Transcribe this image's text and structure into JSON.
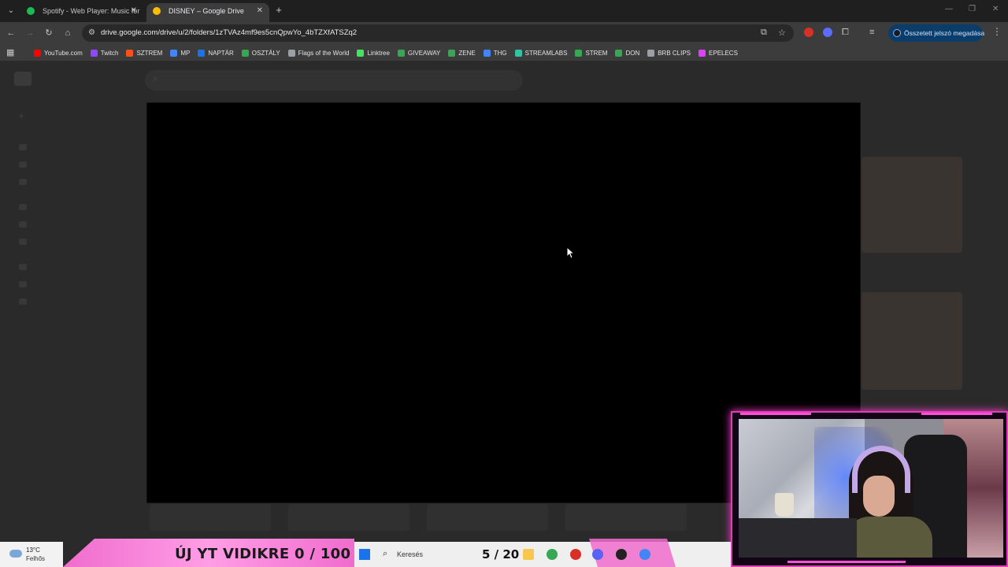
{
  "browser": {
    "tabs": [
      {
        "title": "Spotify - Web Player: Music for",
        "favicon_color": "#1db954",
        "active": false
      },
      {
        "title": "DISNEY – Google Drive",
        "favicon_color": "#fbbc04",
        "active": true
      }
    ],
    "url": "drive.google.com/drive/u/2/folders/1zTVAz4mf9es5cnQpwYo_4bTZXfATSZq2",
    "password_pill": "Összetett jelszó megadása",
    "bookmarks": [
      {
        "label": "YouTube.com",
        "color": "#ff0000"
      },
      {
        "label": "Twitch",
        "color": "#9146ff"
      },
      {
        "label": "SZTREM",
        "color": "#f4511e"
      },
      {
        "label": "MP",
        "color": "#4285f4"
      },
      {
        "label": "NAPTÁR",
        "color": "#1a73e8"
      },
      {
        "label": "OSZTÁLY",
        "color": "#34a853"
      },
      {
        "label": "Flags of the World",
        "color": "#9aa0a6"
      },
      {
        "label": "Linktree",
        "color": "#43e55e"
      },
      {
        "label": "GIVEAWAY",
        "color": "#34a853"
      },
      {
        "label": "ZENE",
        "color": "#34a853"
      },
      {
        "label": "THG",
        "color": "#4285f4"
      },
      {
        "label": "STREAMLABS",
        "color": "#31c3a2"
      },
      {
        "label": "STREM",
        "color": "#34a853"
      },
      {
        "label": "DON",
        "color": "#34a853"
      },
      {
        "label": "BRB CLIPS",
        "color": "#9aa0a6"
      },
      {
        "label": "EPELECS",
        "color": "#e040fb"
      }
    ]
  },
  "overlay": {
    "banner": "ÚJ YT VIDIKRE  0 / 100 $",
    "counter": "5 / 20"
  },
  "taskbar": {
    "weather_temp": "13°C",
    "weather_cond": "Felhős",
    "search_placeholder": "Keresés"
  },
  "colors": {
    "accent_pink": "#f06ccd",
    "cam_border": "#e33db8"
  }
}
